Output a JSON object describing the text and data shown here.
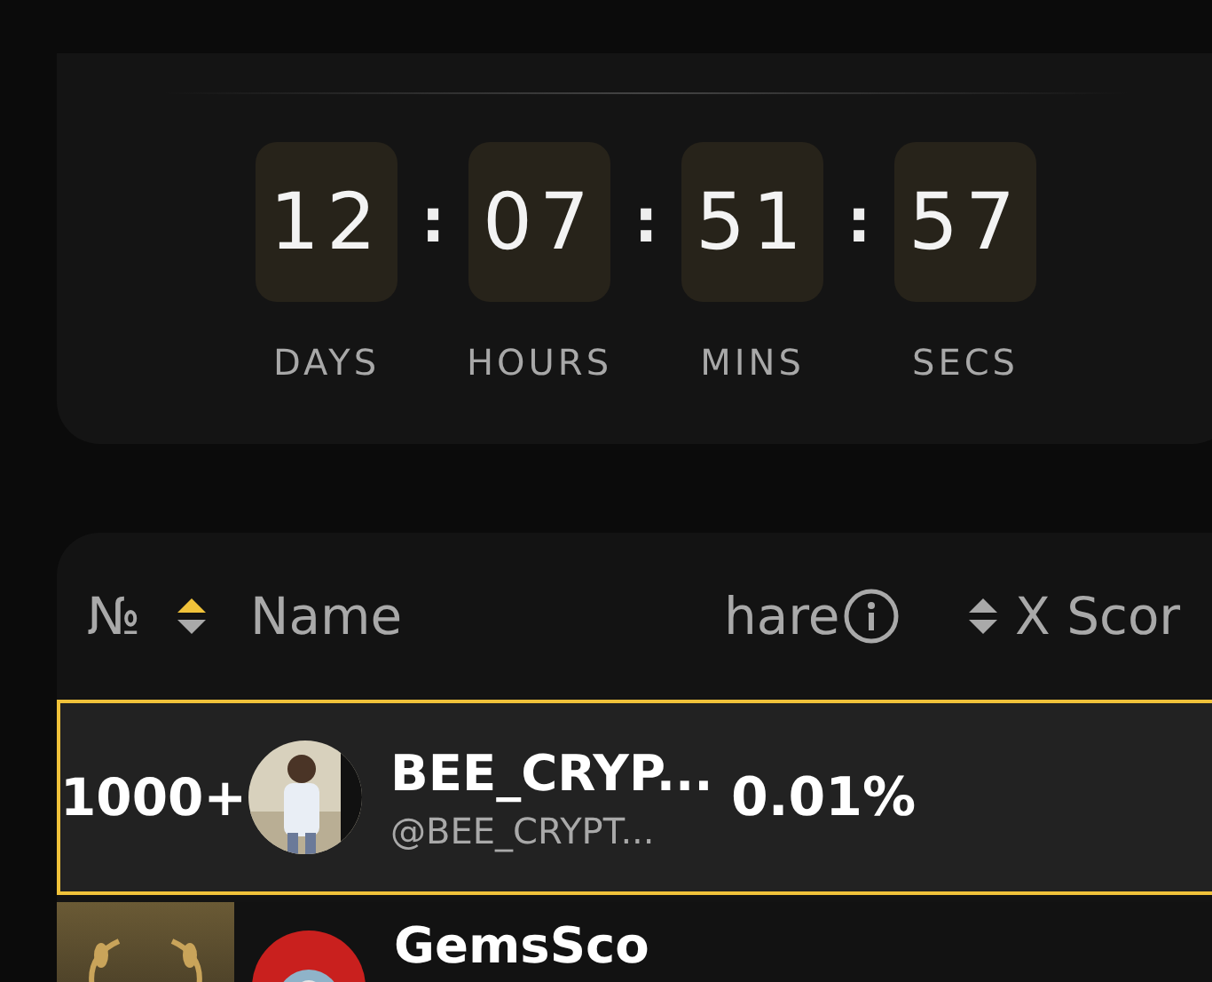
{
  "countdown": {
    "units": [
      {
        "value": "12",
        "label": "DAYS"
      },
      {
        "value": "07",
        "label": "HOURS"
      },
      {
        "value": "51",
        "label": "MINS"
      },
      {
        "value": "57",
        "label": "SECS"
      }
    ],
    "separator": ":"
  },
  "leaderboard": {
    "columns": [
      {
        "kind": "rank",
        "label": "№",
        "sorted_ascending": true
      },
      {
        "kind": "name",
        "label": "Name"
      },
      {
        "kind": "share",
        "label": "hare",
        "info": true,
        "sorted_ascending": false
      },
      {
        "kind": "score",
        "label": "X Scor"
      }
    ],
    "rows": [
      {
        "kind": "ranked",
        "selected": true,
        "rank": "1000+",
        "name": "BEE_CRYP...",
        "handle": "@BEE_CRYPT...",
        "share": "0.01%"
      },
      {
        "kind": "top",
        "selected": false,
        "name": "GemsSco"
      }
    ]
  }
}
